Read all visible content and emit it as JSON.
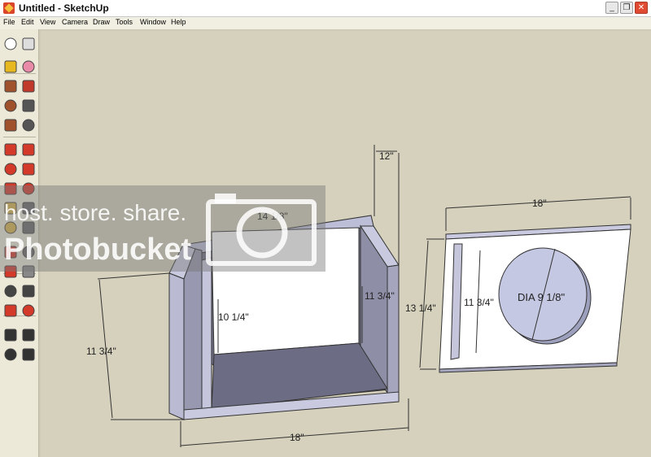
{
  "window": {
    "title": "Untitled - SketchUp",
    "caption_buttons": [
      "_",
      "❐",
      "✕"
    ]
  },
  "menu": [
    "File",
    "Edit",
    "View",
    "Camera",
    "Draw",
    "Tools",
    "Window",
    "Help"
  ],
  "toolbar": {
    "tools": [
      {
        "name": "select-icon",
        "color": "#ffffff"
      },
      {
        "name": "make-component-icon",
        "color": "#dddddd"
      },
      {
        "name": "paint-bucket-icon",
        "color": "#e8b820"
      },
      {
        "name": "eraser-icon",
        "color": "#e88aa8"
      },
      {
        "name": "rectangle-icon",
        "color": "#a0522d"
      },
      {
        "name": "line-pencil-icon",
        "color": "#c0392b"
      },
      {
        "name": "circle-icon",
        "color": "#a0522d"
      },
      {
        "name": "arc-icon",
        "color": "#555555"
      },
      {
        "name": "polygon-icon",
        "color": "#a0522d"
      },
      {
        "name": "freehand-icon",
        "color": "#555555"
      },
      {
        "name": "move-icon",
        "color": "#d43a2a"
      },
      {
        "name": "push-pull-icon",
        "color": "#d43a2a"
      },
      {
        "name": "rotate-icon",
        "color": "#d43a2a"
      },
      {
        "name": "follow-me-icon",
        "color": "#d43a2a"
      },
      {
        "name": "scale-icon",
        "color": "#d43a2a"
      },
      {
        "name": "offset-icon",
        "color": "#d43a2a"
      },
      {
        "name": "tape-measure-icon",
        "color": "#d9b44a"
      },
      {
        "name": "dimension-icon",
        "color": "#666666"
      },
      {
        "name": "protractor-icon",
        "color": "#d9b44a"
      },
      {
        "name": "text-icon",
        "color": "#666666"
      },
      {
        "name": "axes-icon",
        "color": "#d43a2a"
      },
      {
        "name": "3d-text-icon",
        "color": "#666666"
      },
      {
        "name": "orbit-icon",
        "color": "#d43a2a"
      },
      {
        "name": "pan-icon",
        "color": "#888888"
      },
      {
        "name": "zoom-icon",
        "color": "#444444"
      },
      {
        "name": "zoom-extents-icon",
        "color": "#444444"
      },
      {
        "name": "previous-view-icon",
        "color": "#d43a2a"
      },
      {
        "name": "next-view-icon",
        "color": "#d43a2a"
      },
      {
        "name": "position-camera-icon",
        "color": "#333333"
      },
      {
        "name": "look-around-icon",
        "color": "#333333"
      },
      {
        "name": "walk-icon",
        "color": "#333333"
      },
      {
        "name": "section-plane-icon",
        "color": "#333333"
      }
    ]
  },
  "dimensions": {
    "box_height": "11 3/4\"",
    "box_width": "18\"",
    "box_top_width": "14 1/8\"",
    "box_depth": "12\"",
    "inner_height": "10 1/4\"",
    "inner_right": "11 3/4\"",
    "panel_width": "18\"",
    "panel_height": "13 1/4\"",
    "slot_height": "11 3/4\"",
    "hole_diameter": "DIA 9 1/8\""
  },
  "watermark": {
    "line1": "host. store. share.",
    "line2": "Photobucket"
  },
  "colors": {
    "canvas_background": "#d5d1bc",
    "face_front": "#ffffff",
    "face_side": "#8a8aa0",
    "face_light": "#c9cadf",
    "hole_fill": "#c5c8e2"
  }
}
